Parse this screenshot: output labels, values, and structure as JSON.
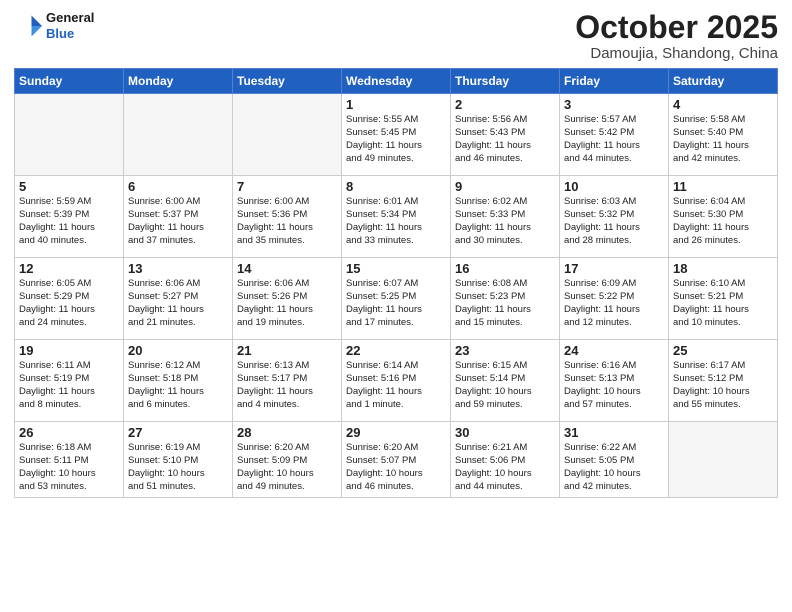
{
  "header": {
    "logo_line1": "General",
    "logo_line2": "Blue",
    "month": "October 2025",
    "location": "Damoujia, Shandong, China"
  },
  "weekdays": [
    "Sunday",
    "Monday",
    "Tuesday",
    "Wednesday",
    "Thursday",
    "Friday",
    "Saturday"
  ],
  "weeks": [
    [
      {
        "day": "",
        "text": ""
      },
      {
        "day": "",
        "text": ""
      },
      {
        "day": "",
        "text": ""
      },
      {
        "day": "1",
        "text": "Sunrise: 5:55 AM\nSunset: 5:45 PM\nDaylight: 11 hours\nand 49 minutes."
      },
      {
        "day": "2",
        "text": "Sunrise: 5:56 AM\nSunset: 5:43 PM\nDaylight: 11 hours\nand 46 minutes."
      },
      {
        "day": "3",
        "text": "Sunrise: 5:57 AM\nSunset: 5:42 PM\nDaylight: 11 hours\nand 44 minutes."
      },
      {
        "day": "4",
        "text": "Sunrise: 5:58 AM\nSunset: 5:40 PM\nDaylight: 11 hours\nand 42 minutes."
      }
    ],
    [
      {
        "day": "5",
        "text": "Sunrise: 5:59 AM\nSunset: 5:39 PM\nDaylight: 11 hours\nand 40 minutes."
      },
      {
        "day": "6",
        "text": "Sunrise: 6:00 AM\nSunset: 5:37 PM\nDaylight: 11 hours\nand 37 minutes."
      },
      {
        "day": "7",
        "text": "Sunrise: 6:00 AM\nSunset: 5:36 PM\nDaylight: 11 hours\nand 35 minutes."
      },
      {
        "day": "8",
        "text": "Sunrise: 6:01 AM\nSunset: 5:34 PM\nDaylight: 11 hours\nand 33 minutes."
      },
      {
        "day": "9",
        "text": "Sunrise: 6:02 AM\nSunset: 5:33 PM\nDaylight: 11 hours\nand 30 minutes."
      },
      {
        "day": "10",
        "text": "Sunrise: 6:03 AM\nSunset: 5:32 PM\nDaylight: 11 hours\nand 28 minutes."
      },
      {
        "day": "11",
        "text": "Sunrise: 6:04 AM\nSunset: 5:30 PM\nDaylight: 11 hours\nand 26 minutes."
      }
    ],
    [
      {
        "day": "12",
        "text": "Sunrise: 6:05 AM\nSunset: 5:29 PM\nDaylight: 11 hours\nand 24 minutes."
      },
      {
        "day": "13",
        "text": "Sunrise: 6:06 AM\nSunset: 5:27 PM\nDaylight: 11 hours\nand 21 minutes."
      },
      {
        "day": "14",
        "text": "Sunrise: 6:06 AM\nSunset: 5:26 PM\nDaylight: 11 hours\nand 19 minutes."
      },
      {
        "day": "15",
        "text": "Sunrise: 6:07 AM\nSunset: 5:25 PM\nDaylight: 11 hours\nand 17 minutes."
      },
      {
        "day": "16",
        "text": "Sunrise: 6:08 AM\nSunset: 5:23 PM\nDaylight: 11 hours\nand 15 minutes."
      },
      {
        "day": "17",
        "text": "Sunrise: 6:09 AM\nSunset: 5:22 PM\nDaylight: 11 hours\nand 12 minutes."
      },
      {
        "day": "18",
        "text": "Sunrise: 6:10 AM\nSunset: 5:21 PM\nDaylight: 11 hours\nand 10 minutes."
      }
    ],
    [
      {
        "day": "19",
        "text": "Sunrise: 6:11 AM\nSunset: 5:19 PM\nDaylight: 11 hours\nand 8 minutes."
      },
      {
        "day": "20",
        "text": "Sunrise: 6:12 AM\nSunset: 5:18 PM\nDaylight: 11 hours\nand 6 minutes."
      },
      {
        "day": "21",
        "text": "Sunrise: 6:13 AM\nSunset: 5:17 PM\nDaylight: 11 hours\nand 4 minutes."
      },
      {
        "day": "22",
        "text": "Sunrise: 6:14 AM\nSunset: 5:16 PM\nDaylight: 11 hours\nand 1 minute."
      },
      {
        "day": "23",
        "text": "Sunrise: 6:15 AM\nSunset: 5:14 PM\nDaylight: 10 hours\nand 59 minutes."
      },
      {
        "day": "24",
        "text": "Sunrise: 6:16 AM\nSunset: 5:13 PM\nDaylight: 10 hours\nand 57 minutes."
      },
      {
        "day": "25",
        "text": "Sunrise: 6:17 AM\nSunset: 5:12 PM\nDaylight: 10 hours\nand 55 minutes."
      }
    ],
    [
      {
        "day": "26",
        "text": "Sunrise: 6:18 AM\nSunset: 5:11 PM\nDaylight: 10 hours\nand 53 minutes."
      },
      {
        "day": "27",
        "text": "Sunrise: 6:19 AM\nSunset: 5:10 PM\nDaylight: 10 hours\nand 51 minutes."
      },
      {
        "day": "28",
        "text": "Sunrise: 6:20 AM\nSunset: 5:09 PM\nDaylight: 10 hours\nand 49 minutes."
      },
      {
        "day": "29",
        "text": "Sunrise: 6:20 AM\nSunset: 5:07 PM\nDaylight: 10 hours\nand 46 minutes."
      },
      {
        "day": "30",
        "text": "Sunrise: 6:21 AM\nSunset: 5:06 PM\nDaylight: 10 hours\nand 44 minutes."
      },
      {
        "day": "31",
        "text": "Sunrise: 6:22 AM\nSunset: 5:05 PM\nDaylight: 10 hours\nand 42 minutes."
      },
      {
        "day": "",
        "text": ""
      }
    ]
  ]
}
